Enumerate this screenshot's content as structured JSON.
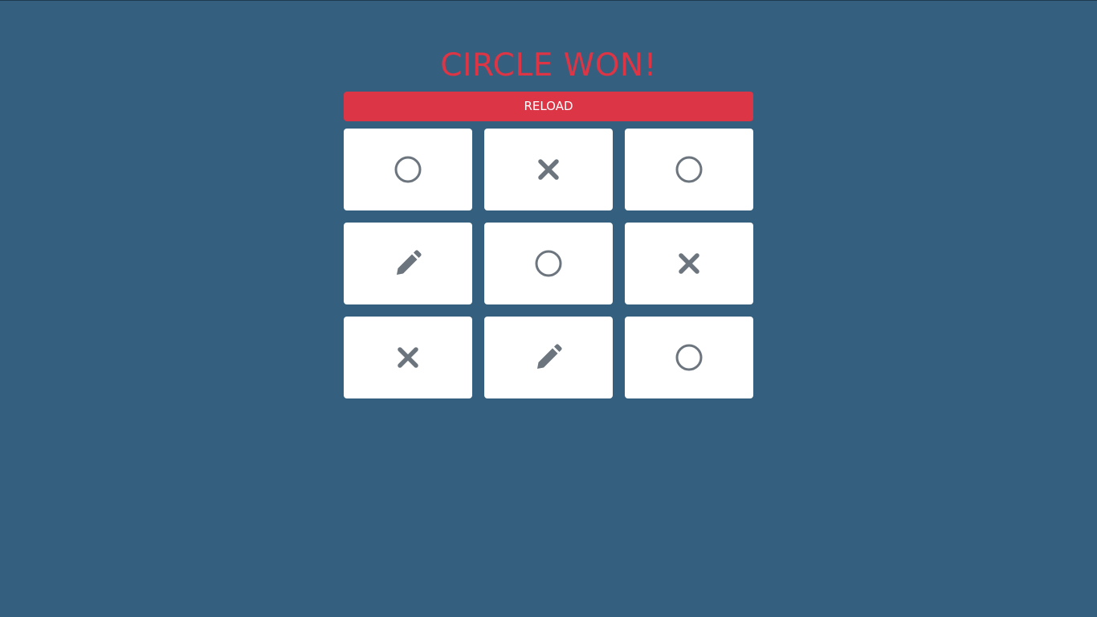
{
  "game": {
    "status_text": "CIRCLE WON!",
    "reload_label": "RELOAD",
    "accent_color": "#dc3545",
    "background_color": "#345f7e",
    "icon_color": "#6c757d"
  },
  "board": {
    "cells": [
      {
        "row": 1,
        "col": 1,
        "mark": "circle",
        "icon": "circle-icon"
      },
      {
        "row": 1,
        "col": 2,
        "mark": "cross",
        "icon": "x-icon"
      },
      {
        "row": 1,
        "col": 3,
        "mark": "circle",
        "icon": "circle-icon"
      },
      {
        "row": 2,
        "col": 1,
        "mark": "empty",
        "icon": "pencil-icon"
      },
      {
        "row": 2,
        "col": 2,
        "mark": "circle",
        "icon": "circle-icon"
      },
      {
        "row": 2,
        "col": 3,
        "mark": "cross",
        "icon": "x-icon"
      },
      {
        "row": 3,
        "col": 1,
        "mark": "cross",
        "icon": "x-icon"
      },
      {
        "row": 3,
        "col": 2,
        "mark": "empty",
        "icon": "pencil-icon"
      },
      {
        "row": 3,
        "col": 3,
        "mark": "circle",
        "icon": "circle-icon"
      }
    ]
  }
}
